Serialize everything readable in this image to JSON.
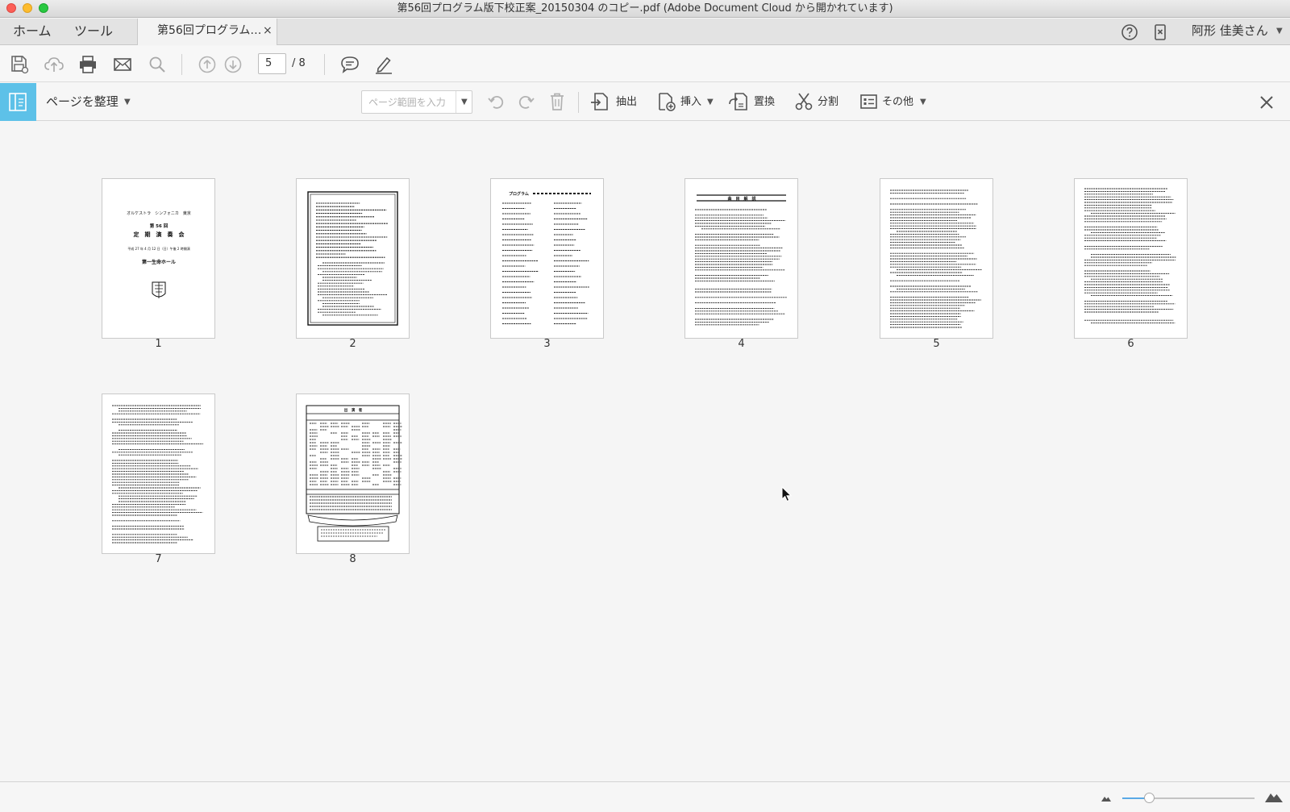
{
  "window": {
    "title": "第56回プログラム版下校正案_20150304 のコピー.pdf (Adobe Document Cloud から開かれています)"
  },
  "tabs": {
    "home": "ホーム",
    "tools": "ツール",
    "document": "第56回プログラム…",
    "close_glyph": "×"
  },
  "account": {
    "user": "阿形 佳美さん"
  },
  "toolbar": {
    "current_page": "5",
    "page_total": "/ 8"
  },
  "organize": {
    "label": "ページを整理",
    "range_placeholder": "ページ範囲を入力",
    "extract": "抽出",
    "insert": "挿入",
    "replace": "置換",
    "split": "分割",
    "more": "その他"
  },
  "pages": [
    "1",
    "2",
    "3",
    "4",
    "5",
    "6",
    "7",
    "8"
  ],
  "thumbnail_text": {
    "p1": {
      "line1": "オルケストラ　シンフォニカ　東京",
      "line2": "第 56 回",
      "line3": "定　期　演　奏　会",
      "line4": "平成 27 年 4 月 12 日（日）午後 2 時開演",
      "line5": "第一生命ホール"
    },
    "p3": {
      "title": "プログラム"
    },
    "p4": {
      "title": "曲　目　解　説"
    },
    "p8": {
      "title": "出　演　者"
    }
  },
  "zoom": {
    "level": 0.2
  }
}
